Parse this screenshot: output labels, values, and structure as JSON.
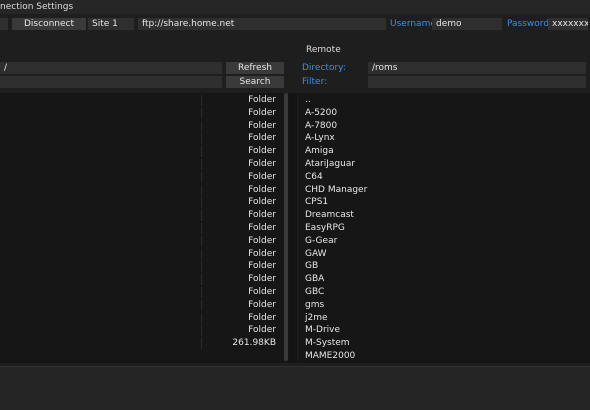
{
  "window": {
    "title": "nection Settings"
  },
  "connection": {
    "disconnect_label": "Disconnect",
    "site": "Site 1",
    "url": "ftp://share.home.net",
    "username_label": "Username:",
    "username": "demo",
    "password_label": "Password:",
    "password": "xxxxxxx"
  },
  "local": {
    "path": "/",
    "refresh_label": "Refresh",
    "search_label": "Search",
    "rows": [
      {
        "name": "",
        "size": "Folder"
      },
      {
        "name": "",
        "size": "Folder"
      },
      {
        "name": "",
        "size": "Folder"
      },
      {
        "name": "",
        "size": "Folder"
      },
      {
        "name": "",
        "size": "Folder"
      },
      {
        "name": "",
        "size": "Folder"
      },
      {
        "name": "",
        "size": "Folder"
      },
      {
        "name": "",
        "size": "Folder"
      },
      {
        "name": "",
        "size": "Folder"
      },
      {
        "name": "",
        "size": "Folder"
      },
      {
        "name": "",
        "size": "Folder"
      },
      {
        "name": "",
        "size": "Folder"
      },
      {
        "name": "",
        "size": "Folder"
      },
      {
        "name": "",
        "size": "Folder"
      },
      {
        "name": "",
        "size": "Folder"
      },
      {
        "name": "",
        "size": "Folder"
      },
      {
        "name": "",
        "size": "Folder"
      },
      {
        "name": "",
        "size": "Folder"
      },
      {
        "name": "",
        "size": "Folder"
      },
      {
        "name": "",
        "size": "261.98KB"
      }
    ]
  },
  "remote": {
    "header": "Remote",
    "directory_label": "Directory:",
    "directory": "/roms",
    "filter_label": "Filter:",
    "filter": "",
    "items": [
      "..",
      "A-5200",
      "A-7800",
      "A-Lynx",
      "Amiga",
      "AtariJaguar",
      "C64",
      "CHD Manager",
      "CPS1",
      "Dreamcast",
      "EasyRPG",
      "G-Gear",
      "GAW",
      "GB",
      "GBA",
      "GBC",
      "gms",
      "j2me",
      "M-Drive",
      "M-System",
      "MAME2000"
    ]
  }
}
